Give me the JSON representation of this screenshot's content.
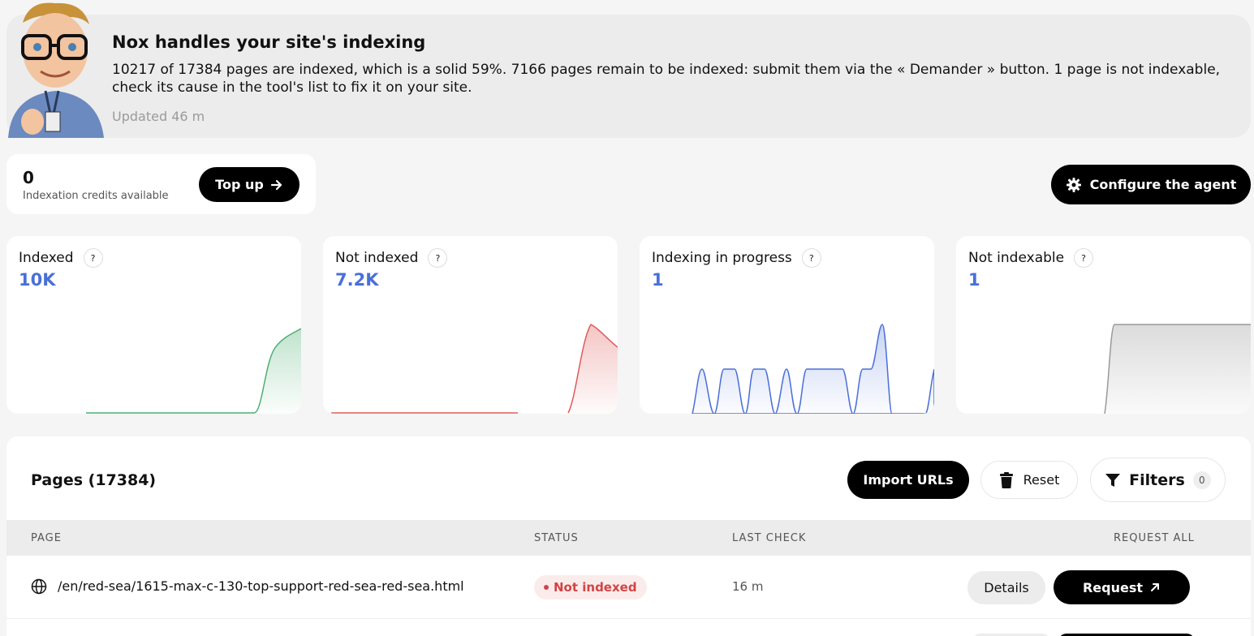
{
  "banner": {
    "title": "Nox handles your site's indexing",
    "text": "10217 of 17384 pages are indexed, which is a solid 59%. 7166 pages remain to be indexed: submit them via the « Demander » button. 1 page is not indexable, check its cause in the tool's list to fix it on your site.",
    "updated": "Updated 46 m"
  },
  "credits": {
    "value": "0",
    "label": "Indexation credits available",
    "topup_label": "Top up"
  },
  "configure_label": "Configure the agent",
  "stats": [
    {
      "title": "Indexed",
      "value": "10K",
      "color": "#4caf72"
    },
    {
      "title": "Not indexed",
      "value": "7.2K",
      "color": "#e05a5a"
    },
    {
      "title": "Indexing in progress",
      "value": "1",
      "color": "#4a6fd8"
    },
    {
      "title": "Not indexable",
      "value": "1",
      "color": "#9a9a9a"
    }
  ],
  "help_glyph": "?",
  "pages": {
    "title": "Pages (17384)",
    "import_label": "Import URLs",
    "reset_label": "Reset",
    "filters_label": "Filters",
    "filters_count": "0",
    "columns": {
      "page": "PAGE",
      "status": "STATUS",
      "last_check": "LAST CHECK",
      "request_all": "REQUEST ALL"
    },
    "rows": [
      {
        "url": "/en/red-sea/1615-max-c-130-top-support-red-sea-red-sea.html",
        "status": "Not indexed",
        "last_check": "16 m",
        "details_label": "Details",
        "request_label": "Request"
      }
    ]
  },
  "colors": {
    "accent": "#4a6fd8",
    "status_not_indexed": "#d24444"
  }
}
